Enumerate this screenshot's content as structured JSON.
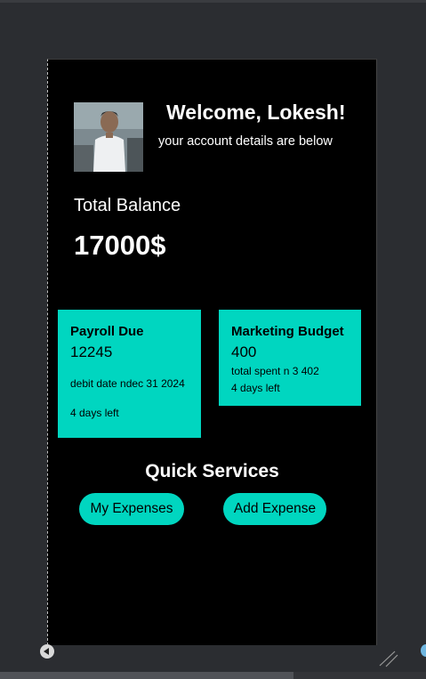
{
  "profile": {
    "welcome": "Welcome, Lokesh!",
    "subtitle": "your account details are below"
  },
  "balance": {
    "label": "Total Balance",
    "value": "17000$"
  },
  "cards": [
    {
      "title": "Payroll Due",
      "amount": "12245",
      "details": [
        "debit date ndec 31 2024",
        "4 days left"
      ]
    },
    {
      "title": "Marketing Budget",
      "amount": "400",
      "details": [
        "total spent n 3 402",
        "4 days left"
      ]
    }
  ],
  "quick_services": {
    "title": "Quick Services",
    "buttons": [
      "My Expenses",
      "Add Expense"
    ]
  },
  "colors": {
    "accent": "#00d6c0",
    "background": "#000000",
    "frame": "#2b2d31"
  },
  "icons": {
    "nav_left": "left-arrow-icon",
    "resize": "resize-handle-icon",
    "nav_right": "circle-icon"
  }
}
